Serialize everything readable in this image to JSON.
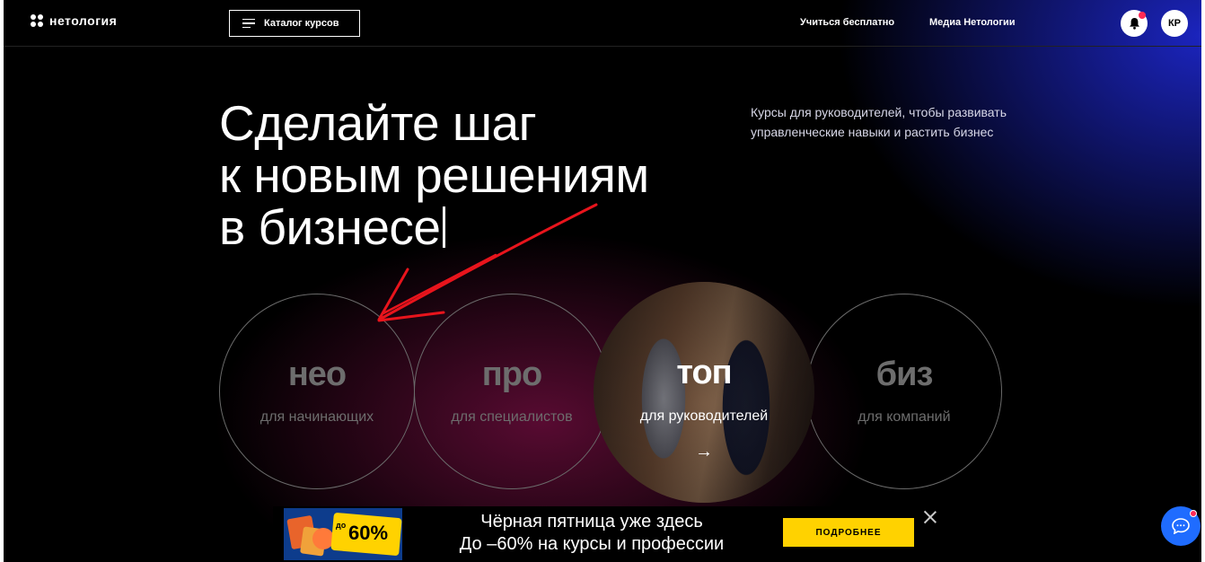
{
  "header": {
    "logo_text": "нетология",
    "catalog_label": "Каталог курсов",
    "nav": [
      "Учиться бесплатно",
      "Медиа Нетологии"
    ],
    "avatar_initials": "КР"
  },
  "hero": {
    "title_lines": [
      "Сделайте шаг",
      "к новым решениям",
      "в бизнесе"
    ],
    "subtitle": "Курсы для руководителей, чтобы развивать управленческие навыки и растить бизнес"
  },
  "levels": [
    {
      "tag": "нео",
      "desc": "для начинающих"
    },
    {
      "tag": "про",
      "desc": "для специалистов"
    },
    {
      "tag": "топ",
      "desc": "для руководителей"
    },
    {
      "tag": "биз",
      "desc": "для компаний"
    }
  ],
  "promo": {
    "badge_prefix": "до",
    "badge_value": "60%",
    "line1": "Чёрная пятница уже здесь",
    "line2": "До –60% на курсы и профессии",
    "button": "ПОДРОБНЕЕ"
  },
  "colors": {
    "accent_yellow": "#ffd200",
    "chat_blue": "#1f6cff",
    "notification_red": "#ff2a55",
    "annotation_red": "#e8141c"
  }
}
